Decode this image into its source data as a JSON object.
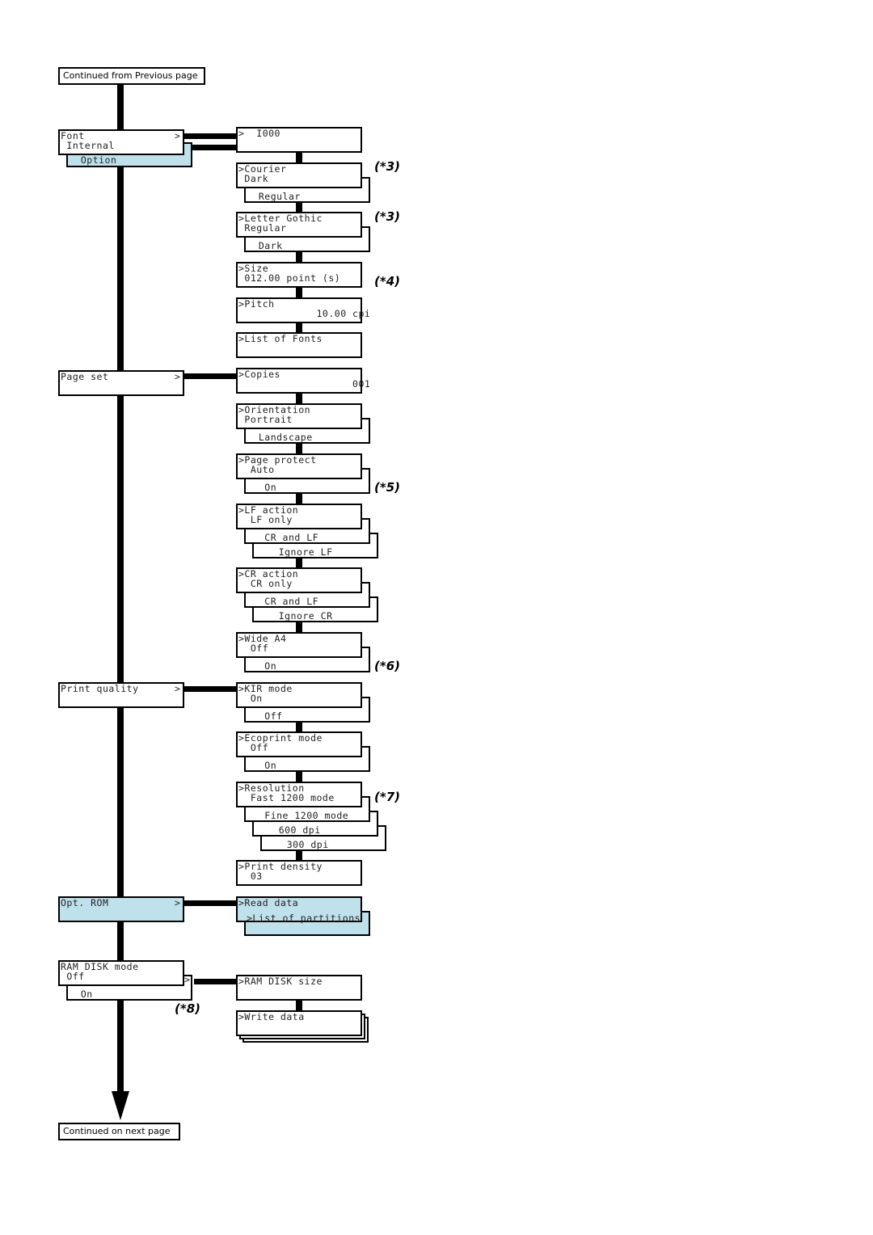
{
  "continued_from": "Continued from Previous page",
  "continued_on": "Continued on next page",
  "left_menus": [
    {
      "id": "font",
      "lines": [
        "Font               >",
        " Internal"
      ],
      "options": [
        "  Option"
      ],
      "highlight_option": true
    },
    {
      "id": "page-set",
      "lines": [
        "Page set           >"
      ]
    },
    {
      "id": "print-quality",
      "lines": [
        "Print quality      >"
      ]
    },
    {
      "id": "opt-rom",
      "lines": [
        "Opt. ROM           >"
      ],
      "highlight": true
    },
    {
      "id": "ram-disk-mode",
      "lines": [
        "RAM DISK mode",
        " Off"
      ],
      "options": [
        "  On"
      ],
      "arrow": ">"
    }
  ],
  "right_menus": [
    {
      "id": "i000",
      "lines": [
        ">  I000"
      ]
    },
    {
      "id": "courier",
      "lines": [
        ">Courier",
        " Dark"
      ],
      "options": [
        "  Regular"
      ]
    },
    {
      "id": "letter-gothic",
      "lines": [
        ">Letter Gothic",
        " Regular"
      ],
      "options": [
        "  Dark"
      ]
    },
    {
      "id": "size",
      "lines": [
        ">Size",
        " 012.00 point (s)"
      ]
    },
    {
      "id": "pitch",
      "lines": [
        ">Pitch",
        "             10.00 cpi"
      ]
    },
    {
      "id": "list-of-fonts",
      "lines": [
        ">List of Fonts"
      ]
    },
    {
      "id": "copies",
      "lines": [
        ">Copies",
        "                   001"
      ]
    },
    {
      "id": "orientation",
      "lines": [
        ">Orientation",
        " Portrait"
      ],
      "options": [
        "  Landscape"
      ]
    },
    {
      "id": "page-protect",
      "lines": [
        ">Page protect",
        "  Auto"
      ],
      "options": [
        "   On"
      ]
    },
    {
      "id": "lf-action",
      "lines": [
        ">LF action",
        "  LF only"
      ],
      "options": [
        "   CR and LF",
        "    Ignore LF"
      ]
    },
    {
      "id": "cr-action",
      "lines": [
        ">CR action",
        "  CR only"
      ],
      "options": [
        "   CR and LF",
        "    Ignore CR"
      ]
    },
    {
      "id": "wide-a4",
      "lines": [
        ">Wide A4",
        "  Off"
      ],
      "options": [
        "   On"
      ]
    },
    {
      "id": "kir-mode",
      "lines": [
        ">KIR mode",
        "  On"
      ],
      "options": [
        "   Off"
      ]
    },
    {
      "id": "ecoprint-mode",
      "lines": [
        ">Ecoprint mode",
        "  Off"
      ],
      "options": [
        "   On"
      ]
    },
    {
      "id": "resolution",
      "lines": [
        ">Resolution",
        "  Fast 1200 mode"
      ],
      "options": [
        "   Fine 1200 mode",
        "    600 dpi",
        "    300 dpi"
      ]
    },
    {
      "id": "print-density",
      "lines": [
        ">Print density",
        "  03"
      ]
    },
    {
      "id": "read-data",
      "lines": [
        ">Read data"
      ],
      "options": [
        ">List of partitions"
      ],
      "highlight": true
    },
    {
      "id": "ram-disk-size",
      "lines": [
        ">RAM DISK size"
      ]
    },
    {
      "id": "write-data",
      "lines": [
        ">Write data"
      ],
      "stacked": true
    }
  ],
  "notes": [
    "(*3)",
    "(*3)",
    "(*4)",
    "(*5)",
    "(*6)",
    "(*7)",
    "(*8)"
  ],
  "colors": {
    "highlight": "#bfe1ec",
    "line": "#000000"
  }
}
